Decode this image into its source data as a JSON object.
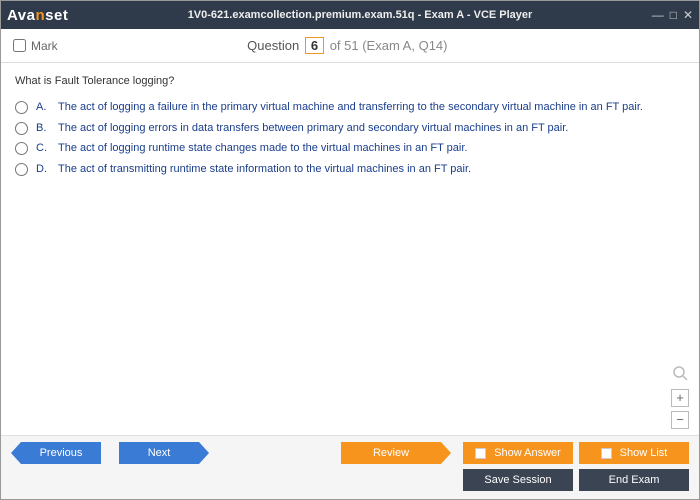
{
  "titlebar": {
    "logo_pre": "Ava",
    "logo_orange": "n",
    "logo_post": "set",
    "title": "1V0-621.examcollection.premium.exam.51q - Exam A - VCE Player"
  },
  "header": {
    "mark_label": "Mark",
    "question_word": "Question",
    "current_num": "6",
    "of_text": " of 51 (Exam A, Q14)"
  },
  "question": {
    "text": "What is Fault Tolerance logging?",
    "options": [
      {
        "label": "A.",
        "text": "The act of logging a failure in the primary virtual machine and transferring to the secondary virtual machine in an FT pair."
      },
      {
        "label": "B.",
        "text": "The act of logging errors in data transfers between primary and secondary virtual machines in an FT pair."
      },
      {
        "label": "C.",
        "text": "The act of logging runtime state changes made to the virtual machines in an FT pair."
      },
      {
        "label": "D.",
        "text": "The act of transmitting runtime state information to the virtual machines in an FT pair."
      }
    ]
  },
  "zoom": {
    "plus": "+",
    "minus": "−"
  },
  "footer": {
    "previous": "Previous",
    "next": "Next",
    "review": "Review",
    "show_answer": "Show Answer",
    "show_list": "Show List",
    "save_session": "Save Session",
    "end_exam": "End Exam"
  }
}
